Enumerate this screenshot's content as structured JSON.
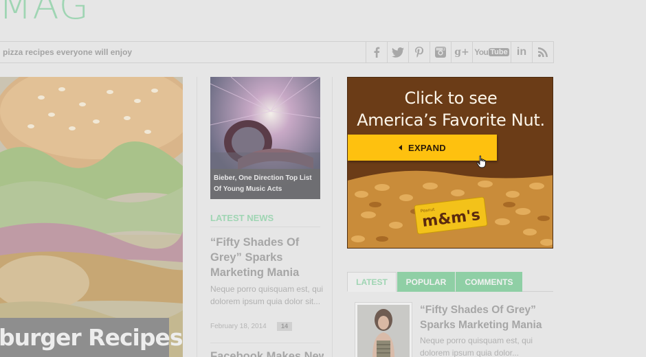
{
  "site": {
    "logo_text": "MAG"
  },
  "topbar": {
    "ticker": "pizza recipes everyone will enjoy",
    "social_icons": [
      "facebook-icon",
      "twitter-icon",
      "pinterest-icon",
      "instagram-icon",
      "google-plus-icon",
      "youtube-icon",
      "linkedin-icon",
      "rss-icon"
    ],
    "youtube_label": "YouTube",
    "linkedin_label": "in",
    "gplus_label": "g+"
  },
  "hero": {
    "caption": "burger Recipes"
  },
  "featured": {
    "caption": "Bieber, One Direction Top List Of Young Music Acts"
  },
  "latest_news": {
    "heading": "LATEST NEWS",
    "article": {
      "title": "“Fifty Shades Of Grey” Sparks Marketing Mania",
      "excerpt": "Neque porro quisquam est, qui dolorem ipsum quia dolor sit...",
      "date": "February 18, 2014",
      "comments": "14"
    },
    "next_title": "Facebook Makes New"
  },
  "ad": {
    "headline_line1": "Click to see",
    "headline_line2": "America’s Favorite Nut.",
    "button_label": "EXPAND",
    "brand_small": "Peanut",
    "brand": "m&m's",
    "colors": {
      "background": "#6b3c17",
      "button": "#fec10f"
    }
  },
  "sidebar_tabs": {
    "tabs": [
      {
        "label": "LATEST",
        "active": true
      },
      {
        "label": "POPULAR",
        "active": false
      },
      {
        "label": "COMMENTS",
        "active": false
      }
    ],
    "item": {
      "title": "“Fifty Shades Of Grey” Sparks Marketing Mania",
      "excerpt": "Neque porro quisquam est, qui dolorem ipsum quia dolor..."
    }
  },
  "colors": {
    "accent": "#9fd5b3",
    "tab_green": "#8fcfa5",
    "page_bg": "#e6e6e6"
  }
}
